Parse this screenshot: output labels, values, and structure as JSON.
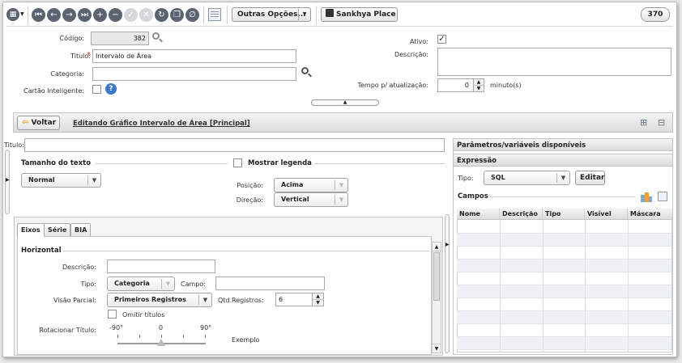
{
  "toolbar": {
    "opcoes_label": "Outras Opções...",
    "sankhya_label": "Sankhya Place",
    "badge": "370"
  },
  "form": {
    "codigo_label": "Código:",
    "codigo_value": "382",
    "titulo_label": "Titulo:",
    "titulo_value": "Intervalo de Área",
    "categoria_label": "Categoria:",
    "categoria_value": "",
    "cartao_label": "Cartão Inteligente:",
    "ativo_label": "Ativo:",
    "descricao_label": "Descrição:",
    "descricao_value": "",
    "tempo_label": "Tempo p/ atualização:",
    "tempo_value": "0",
    "tempo_unit": "minuto(s)"
  },
  "editor_bar": {
    "voltar_label": "Voltar",
    "heading": "Editando Gráfico Intervalo de Área [Principal]"
  },
  "chart_form": {
    "titulo_label": "Titulo:",
    "titulo_value": "",
    "tamanho_title": "Tamanho do texto",
    "tamanho_value": "Normal",
    "legenda_label": "Mostrar legenda",
    "posicao_label": "Posição:",
    "posicao_value": "Acima",
    "direcao_label": "Direção:",
    "direcao_value": "Vertical"
  },
  "tabs": [
    "Eixos",
    "Série",
    "BIA"
  ],
  "eixos": {
    "horizontal_title": "Horizontal",
    "descricao_label": "Descrição:",
    "tipo_label": "Tipo:",
    "tipo_value": "Categoria",
    "campo_label": "Campo:",
    "visao_label": "Visão Parcial:",
    "visao_value": "Primeiros Registros",
    "qtd_label": "Qtd.Registros:",
    "qtd_value": "6",
    "omitir_label": "Omitir títulos",
    "rotacionar_label": "Rotacionar Título:",
    "slider_min": "-90°",
    "slider_mid": "0",
    "slider_max": "90°",
    "exemplo_label": "Exemplo"
  },
  "right_panel": {
    "params_title": "Parâmetros/variáveis disponíveis",
    "expressao_title": "Expressão",
    "tipo_label": "Tipo:",
    "tipo_value": "SQL",
    "editar_label": "Editar",
    "campos_title": "Campos",
    "columns": [
      "Nome",
      "Descrição",
      "Tipo",
      "Visível",
      "Máscara"
    ]
  }
}
